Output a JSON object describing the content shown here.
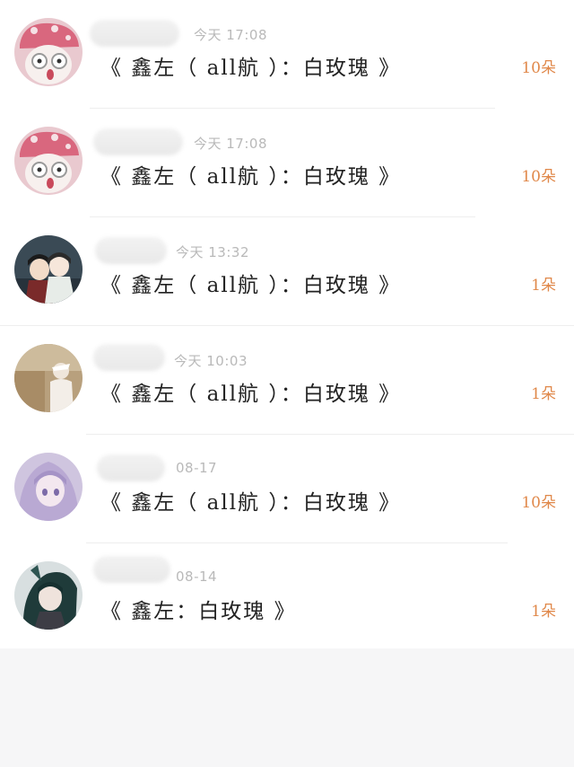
{
  "messages": [
    {
      "time": "今天 17:08",
      "title": "《 鑫左（ all航 ）：白玫瑰 》",
      "count": "10朵",
      "avatar": "pink-hat-character-avatar"
    },
    {
      "time": "今天 17:08",
      "title": "《 鑫左（ all航 ）：白玫瑰 》",
      "count": "10朵",
      "avatar": "pink-hat-character-avatar"
    },
    {
      "time": "今天 13:32",
      "title": "《 鑫左（ all航 ）：白玫瑰 》",
      "count": "1朵",
      "avatar": "anime-pair-avatar"
    },
    {
      "time": "今天 10:03",
      "title": "《 鑫左（ all航 ）：白玫瑰 》",
      "count": "1朵",
      "avatar": "photo-person-avatar"
    },
    {
      "time": "08-17",
      "title": "《 鑫左（ all航 ）：白玫瑰 》",
      "count": "10朵",
      "avatar": "purple-hair-anime-avatar"
    },
    {
      "time": "08-14",
      "title": "《 鑫左：白玫瑰 》",
      "count": "1朵",
      "avatar": "dark-hair-anime-avatar"
    }
  ]
}
